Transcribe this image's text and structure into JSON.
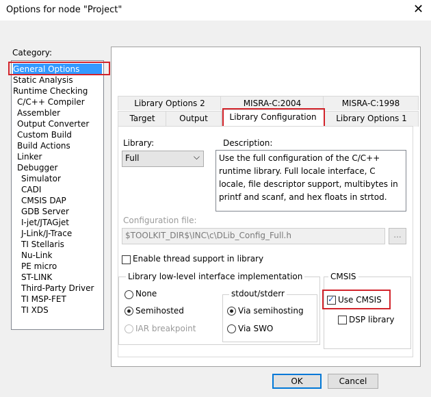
{
  "window": {
    "title": "Options for node \"Project\""
  },
  "category": {
    "label": "Category:",
    "items": [
      {
        "label": "General Options",
        "selected": true
      },
      {
        "label": "Static Analysis"
      },
      {
        "label": "Runtime Checking"
      },
      {
        "label": "C/C++ Compiler"
      },
      {
        "label": "Assembler"
      },
      {
        "label": "Output Converter"
      },
      {
        "label": "Custom Build"
      },
      {
        "label": "Build Actions"
      },
      {
        "label": "Linker"
      },
      {
        "label": "Debugger"
      },
      {
        "label": "Simulator"
      },
      {
        "label": "CADI"
      },
      {
        "label": "CMSIS DAP"
      },
      {
        "label": "GDB Server"
      },
      {
        "label": "I-jet/JTAGjet"
      },
      {
        "label": "J-Link/J-Trace"
      },
      {
        "label": "TI Stellaris"
      },
      {
        "label": "Nu-Link"
      },
      {
        "label": "PE micro"
      },
      {
        "label": "ST-LINK"
      },
      {
        "label": "Third-Party Driver"
      },
      {
        "label": "TI MSP-FET"
      },
      {
        "label": "TI XDS"
      }
    ]
  },
  "tabs": {
    "row1": [
      "Library Options 2",
      "MISRA-C:2004",
      "MISRA-C:1998"
    ],
    "row2": [
      "Target",
      "Output",
      "Library Configuration",
      "Library Options 1"
    ],
    "active": "Library Configuration"
  },
  "library": {
    "label": "Library:",
    "value": "Full",
    "description_label": "Description:",
    "description": "Use the full configuration of the C/C++ runtime library. Full locale interface, C locale, file descriptor support, multibytes in printf and scanf, and hex floats in strtod."
  },
  "config_file": {
    "label": "Configuration file:",
    "value": "$TOOLKIT_DIR$\\INC\\c\\DLib_Config_Full.h",
    "browse_label": "..."
  },
  "thread_support": {
    "label": "Enable thread support in library",
    "checked": false
  },
  "low_level": {
    "legend": "Library low-level interface implementation",
    "options": [
      {
        "label": "None",
        "selected": false,
        "disabled": false
      },
      {
        "label": "Semihosted",
        "selected": true,
        "disabled": false
      },
      {
        "label": "IAR breakpoint",
        "selected": false,
        "disabled": true
      }
    ],
    "stdout": {
      "legend": "stdout/stderr",
      "options": [
        {
          "label": "Via semihosting",
          "selected": true
        },
        {
          "label": "Via SWO",
          "selected": false
        }
      ]
    }
  },
  "cmsis": {
    "legend": "CMSIS",
    "use_cmsis": {
      "label": "Use CMSIS",
      "checked": true
    },
    "dsp_library": {
      "label": "DSP library",
      "checked": false
    }
  },
  "buttons": {
    "ok": "OK",
    "cancel": "Cancel"
  }
}
